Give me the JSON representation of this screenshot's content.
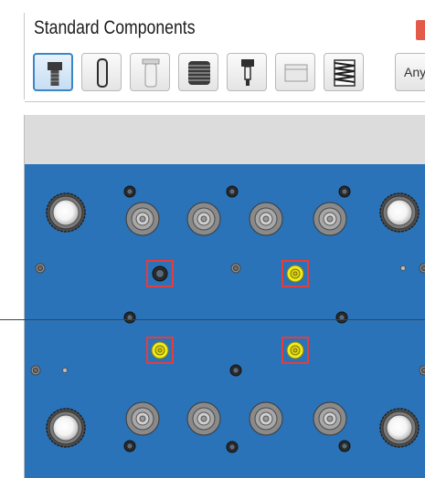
{
  "panel": {
    "title": "Standard Components",
    "toolbar": {
      "buttons": [
        {
          "name": "socket-head-screw",
          "icon": "socket-screw-icon",
          "selected": true
        },
        {
          "name": "dowel-pin",
          "icon": "dowel-pin-icon",
          "selected": false
        },
        {
          "name": "sleeve",
          "icon": "sleeve-icon",
          "selected": false
        },
        {
          "name": "stacked-disc",
          "icon": "stacked-disc-icon",
          "selected": false
        },
        {
          "name": "ejector-pin",
          "icon": "ejector-pin-icon",
          "selected": false
        },
        {
          "name": "plate-block",
          "icon": "plate-block-icon",
          "selected": false
        },
        {
          "name": "spring",
          "icon": "spring-icon",
          "selected": false
        }
      ],
      "any_label": "Any"
    }
  },
  "cad_view": {
    "plate_color": "#2a73b8",
    "highlight_color": "#e63c3c",
    "selected_fill": "#f1ec18"
  }
}
